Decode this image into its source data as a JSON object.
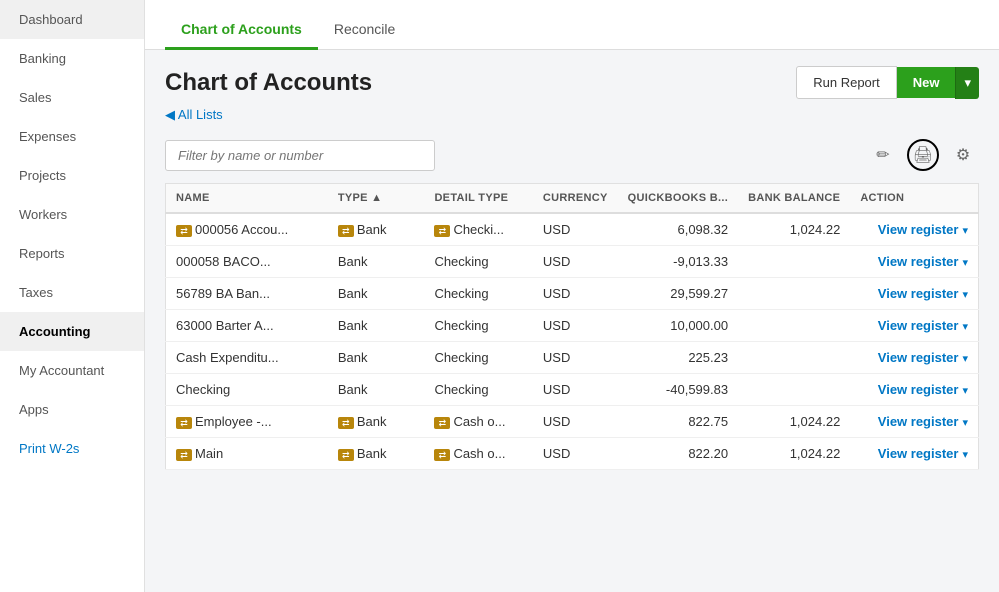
{
  "sidebar": {
    "items": [
      {
        "id": "dashboard",
        "label": "Dashboard",
        "active": false
      },
      {
        "id": "banking",
        "label": "Banking",
        "active": false
      },
      {
        "id": "sales",
        "label": "Sales",
        "active": false
      },
      {
        "id": "expenses",
        "label": "Expenses",
        "active": false
      },
      {
        "id": "projects",
        "label": "Projects",
        "active": false
      },
      {
        "id": "workers",
        "label": "Workers",
        "active": false
      },
      {
        "id": "reports",
        "label": "Reports",
        "active": false
      },
      {
        "id": "taxes",
        "label": "Taxes",
        "active": false
      },
      {
        "id": "accounting",
        "label": "Accounting",
        "active": true
      },
      {
        "id": "my-accountant",
        "label": "My Accountant",
        "active": false
      },
      {
        "id": "apps",
        "label": "Apps",
        "active": false
      },
      {
        "id": "print-w2s",
        "label": "Print W-2s",
        "active": false
      }
    ]
  },
  "tabs": [
    {
      "id": "chart-of-accounts",
      "label": "Chart of Accounts",
      "active": true
    },
    {
      "id": "reconcile",
      "label": "Reconcile",
      "active": false
    }
  ],
  "header": {
    "page_title": "Chart of Accounts",
    "run_report_label": "Run Report",
    "new_label": "New"
  },
  "breadcrumb": {
    "label": "◀ All Lists"
  },
  "filter": {
    "placeholder": "Filter by name or number"
  },
  "table": {
    "columns": [
      {
        "id": "name",
        "label": "NAME"
      },
      {
        "id": "type",
        "label": "TYPE ▲",
        "sortable": true
      },
      {
        "id": "detail_type",
        "label": "DETAIL TYPE"
      },
      {
        "id": "currency",
        "label": "CURRENCY"
      },
      {
        "id": "quickbooks_balance",
        "label": "QUICKBOOKS B..."
      },
      {
        "id": "bank_balance",
        "label": "BANK BALANCE"
      },
      {
        "id": "action",
        "label": "ACTION"
      }
    ],
    "rows": [
      {
        "name": "000056 Accou...",
        "name_icon": true,
        "type": "Bank",
        "type_icon": true,
        "detail_type": "Checki...",
        "detail_icon": true,
        "currency": "USD",
        "quickbooks_balance": "6,098.32",
        "bank_balance": "1,024.22",
        "action": "View register"
      },
      {
        "name": "000058 BACO...",
        "name_icon": false,
        "type": "Bank",
        "type_icon": false,
        "detail_type": "Checking",
        "detail_icon": false,
        "currency": "USD",
        "quickbooks_balance": "-9,013.33",
        "bank_balance": "",
        "action": "View register"
      },
      {
        "name": "56789 BA Ban...",
        "name_icon": false,
        "type": "Bank",
        "type_icon": false,
        "detail_type": "Checking",
        "detail_icon": false,
        "currency": "USD",
        "quickbooks_balance": "29,599.27",
        "bank_balance": "",
        "action": "View register"
      },
      {
        "name": "63000 Barter A...",
        "name_icon": false,
        "type": "Bank",
        "type_icon": false,
        "detail_type": "Checking",
        "detail_icon": false,
        "currency": "USD",
        "quickbooks_balance": "10,000.00",
        "bank_balance": "",
        "action": "View register"
      },
      {
        "name": "Cash Expenditu...",
        "name_icon": false,
        "type": "Bank",
        "type_icon": false,
        "detail_type": "Checking",
        "detail_icon": false,
        "currency": "USD",
        "quickbooks_balance": "225.23",
        "bank_balance": "",
        "action": "View register"
      },
      {
        "name": "Checking",
        "name_icon": false,
        "type": "Bank",
        "type_icon": false,
        "detail_type": "Checking",
        "detail_icon": false,
        "currency": "USD",
        "quickbooks_balance": "-40,599.83",
        "bank_balance": "",
        "action": "View register"
      },
      {
        "name": "Employee -...",
        "name_icon": true,
        "type": "Bank",
        "type_icon": true,
        "detail_type": "Cash o...",
        "detail_icon": true,
        "currency": "USD",
        "quickbooks_balance": "822.75",
        "bank_balance": "1,024.22",
        "action": "View register"
      },
      {
        "name": "Main",
        "name_icon": true,
        "type": "Bank",
        "type_icon": true,
        "detail_type": "Cash o...",
        "detail_icon": true,
        "currency": "USD",
        "quickbooks_balance": "822.20",
        "bank_balance": "1,024.22",
        "action": "View register"
      }
    ]
  },
  "icons": {
    "pencil": "✏",
    "print": "🖨",
    "gear": "⚙"
  }
}
